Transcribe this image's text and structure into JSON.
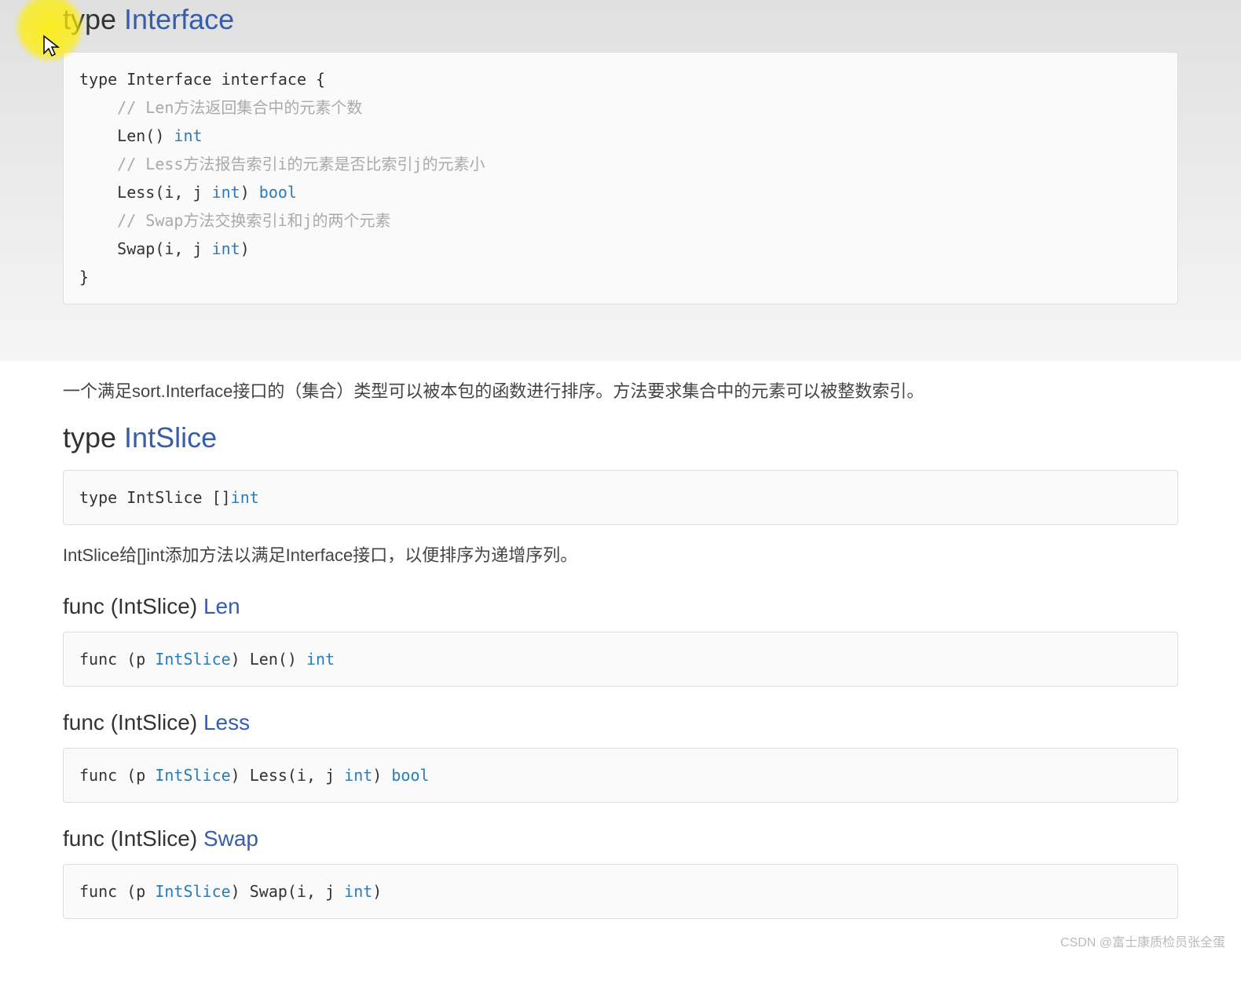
{
  "sections": {
    "interface": {
      "heading_prefix": "type ",
      "heading_name": "Interface",
      "code_html": "type Interface interface {\n    <span class=\"comment\">// Len方法返回集合中的元素个数</span>\n    Len() <span class=\"type\">int</span>\n    <span class=\"comment\">// Less方法报告索引i的元素是否比索引j的元素小</span>\n    Less(i, j <span class=\"type\">int</span>) <span class=\"type\">bool</span>\n    <span class=\"comment\">// Swap方法交换索引i和j的两个元素</span>\n    Swap(i, j <span class=\"type\">int</span>)\n}",
      "desc": "一个满足sort.Interface接口的（集合）类型可以被本包的函数进行排序。方法要求集合中的元素可以被整数索引。"
    },
    "intslice": {
      "heading_prefix": "type ",
      "heading_name": "IntSlice",
      "code_html": "type IntSlice []<span class=\"type\">int</span>",
      "desc": "IntSlice给[]int添加方法以满足Interface接口，以便排序为递增序列。"
    },
    "len_fn": {
      "heading_prefix": "func (IntSlice) ",
      "heading_name": "Len",
      "code_html": "func (p <span class=\"ident\">IntSlice</span>) Len() <span class=\"type\">int</span>"
    },
    "less_fn": {
      "heading_prefix": "func (IntSlice) ",
      "heading_name": "Less",
      "code_html": "func (p <span class=\"ident\">IntSlice</span>) Less(i, j <span class=\"type\">int</span>) <span class=\"type\">bool</span>"
    },
    "swap_fn": {
      "heading_prefix": "func (IntSlice) ",
      "heading_name": "Swap",
      "code_html": "func (p <span class=\"ident\">IntSlice</span>) Swap(i, j <span class=\"type\">int</span>)"
    }
  },
  "watermark": "CSDN @富士康质检员张全蛋"
}
